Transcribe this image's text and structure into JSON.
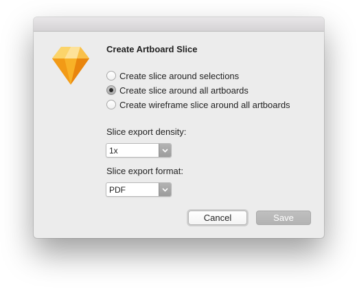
{
  "dialog": {
    "title": "Create Artboard Slice",
    "app_icon": "sketch-diamond-icon",
    "options": [
      {
        "label": "Create slice around selections",
        "checked": false
      },
      {
        "label": "Create slice around all artboards",
        "checked": true
      },
      {
        "label": "Create wireframe slice around all artboards",
        "checked": false
      }
    ],
    "density": {
      "label": "Slice export density:",
      "value": "1x"
    },
    "format": {
      "label": "Slice export format:",
      "value": "PDF"
    },
    "buttons": {
      "cancel_label": "Cancel",
      "save_label": "Save"
    }
  },
  "colors": {
    "dialog_background": "#ececec",
    "accent_orange": "#f5a623",
    "disabled_button": "#b8b8b8"
  }
}
